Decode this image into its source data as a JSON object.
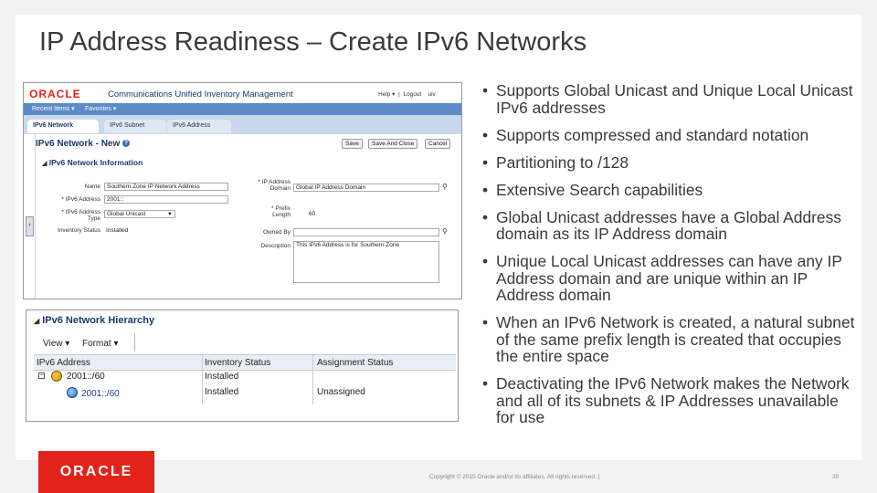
{
  "slide": {
    "title": "IP Address Readiness – Create IPv6 Networks",
    "bullets": [
      "Supports Global Unicast and Unique Local Unicast IPv6 addresses",
      "Supports compressed and standard notation",
      "Partitioning to /128",
      "Extensive Search capabilities",
      "Global Unicast addresses have a Global Address domain as its IP Address domain",
      "Unique Local Unicast addresses can have any IP Address domain and are unique within an IP Address domain",
      "When an IPv6 Network is created, a natural subnet of the same prefix length is created that occupies the entire space",
      "Deactivating the IPv6 Network makes the Network and all of its subnets & IP Addresses unavailable for use"
    ],
    "footer_logo": "ORACLE",
    "copyright": "Copyright © 2015 Oracle and/or its affiliates. All rights reserved. |",
    "page_number": "30",
    "accent_color": "#e2231a"
  },
  "app": {
    "logo": "ORACLE",
    "name": "Communications Unified Inventory Management",
    "help": "Help ▾",
    "logout": "Logout",
    "user": "uiv",
    "menu": [
      "Recent Items ▾",
      "Favorites ▾"
    ],
    "tabs": [
      "IPv6 Network",
      "IPv6 Subnet",
      "IPv6 Address"
    ],
    "page_title": "IPv6 Network - New",
    "buttons": {
      "save": "Save",
      "save_close": "Save And Close",
      "cancel": "Cancel"
    },
    "section_title": "IPv6 Network Information",
    "form": {
      "name_label": "Name",
      "name_value": "Southern Zone IP Network Address",
      "address_label": "* IPv6 Address",
      "address_value": "2001::",
      "type_label": "* IPv6 Address Type",
      "type_value": "Global Unicast",
      "inv_status_label": "Inventory Status",
      "inv_status_value": "Installed",
      "domain_label": "* IP Address Domain",
      "domain_value": "Global IP Address Domain",
      "prefix_label": "* Prefix Length",
      "prefix_value": "60",
      "owned_label": "Owned By",
      "owned_value": "",
      "desc_label": "Description",
      "desc_value": "This IPv6 Address is for Southern Zone"
    }
  },
  "hierarchy": {
    "title": "IPv6 Network Hierarchy",
    "view": "View ▾",
    "format": "Format ▾",
    "columns": [
      "IPv6 Address",
      "Inventory Status",
      "Assignment Status"
    ],
    "rows": [
      {
        "address": "2001::/60",
        "inventory": "Installed",
        "assignment": ""
      },
      {
        "address": "2001::/60",
        "inventory": "Installed",
        "assignment": "Unassigned"
      }
    ]
  }
}
